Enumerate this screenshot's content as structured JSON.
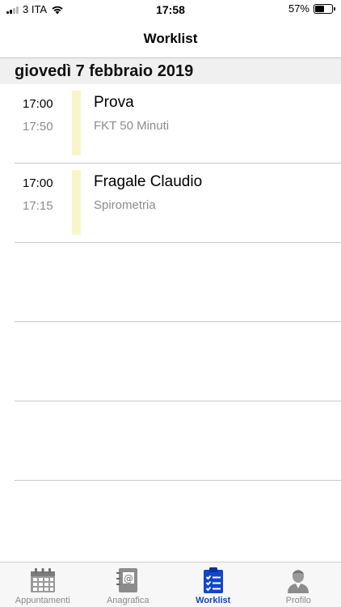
{
  "status_bar": {
    "carrier": "3 ITA",
    "time": "17:58",
    "battery_percent": "57%",
    "battery_level": 0.57
  },
  "nav": {
    "title": "Worklist"
  },
  "section": {
    "date": "giovedì 7 febbraio 2019"
  },
  "appointments": [
    {
      "start": "17:00",
      "end": "17:50",
      "title": "Prova",
      "subtitle": "FKT 50 Minuti"
    },
    {
      "start": "17:00",
      "end": "17:15",
      "title": "Fragale Claudio",
      "subtitle": "Spirometria"
    }
  ],
  "tabs": [
    {
      "label": "Appuntamenti",
      "icon": "calendar-icon"
    },
    {
      "label": "Anagrafica",
      "icon": "address-book-icon"
    },
    {
      "label": "Worklist",
      "icon": "clipboard-checklist-icon"
    },
    {
      "label": "Profilo",
      "icon": "user-profile-icon"
    }
  ],
  "colors": {
    "accent": "#1346c8",
    "tab_inactive": "#8a8a8a",
    "appointment_bar": "#f6f6c9",
    "section_bg": "#f0f0f0"
  }
}
